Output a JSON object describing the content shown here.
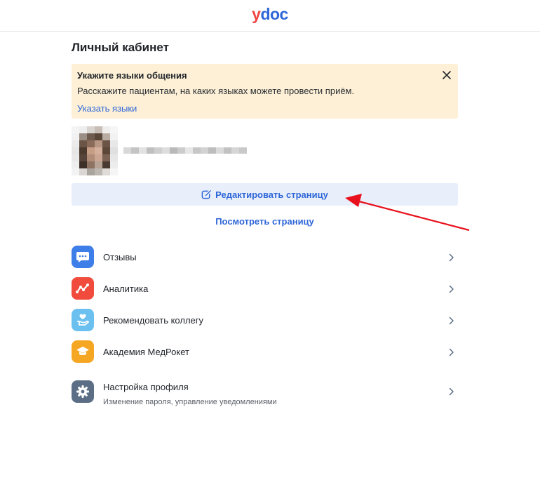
{
  "header": {
    "logo_first": "y",
    "logo_rest": "doc"
  },
  "page": {
    "title": "Личный кабинет"
  },
  "notice": {
    "title": "Укажите языки общения",
    "text": "Расскажите пациентам, на каких языках можете провести приём.",
    "link": "Указать языки",
    "background": "#fdf0d6"
  },
  "profile": {
    "edit_label": "Редактировать страницу",
    "view_label": "Посмотреть страницу"
  },
  "menu": {
    "items": [
      {
        "label": "Отзывы",
        "icon": "chat-bubble-icon",
        "color": "#3d7ee8"
      },
      {
        "label": "Аналитика",
        "icon": "analytics-icon",
        "color": "#f04b3c"
      },
      {
        "label": "Рекомендовать коллегу",
        "icon": "heart-hand-icon",
        "color": "#6bc0f0"
      },
      {
        "label": "Академия МедРокет",
        "icon": "graduation-cap-icon",
        "color": "#f5a623"
      },
      {
        "label": "Настройка профиля",
        "sublabel": "Изменение пароля, управление уведомлениями",
        "icon": "gear-icon",
        "color": "#5b6e85"
      }
    ]
  },
  "colors": {
    "accent": "#2f67d8",
    "logo_red": "#ef4444",
    "annotation_arrow": "#e8101c"
  }
}
